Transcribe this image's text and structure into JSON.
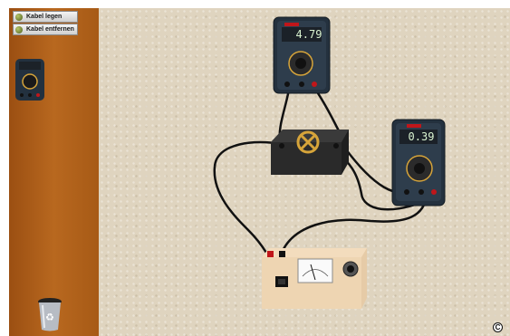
{
  "toolbar": {
    "lay_cable_label": "Kabel legen",
    "remove_cable_label": "Kabel entfernen"
  },
  "multimeters": {
    "top_reading": "4.79",
    "right_reading": "0.39"
  },
  "copyright_symbol": "C",
  "colors": {
    "sidebar": "#b8681f",
    "workspace": "#dfd4bf",
    "cable": "#111111",
    "red_terminal": "#c0161a"
  }
}
